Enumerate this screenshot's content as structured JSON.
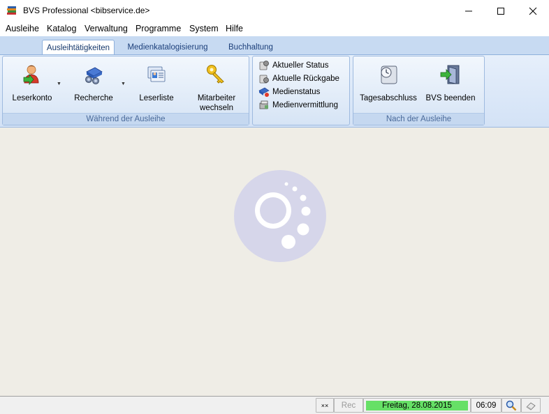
{
  "window": {
    "title": "BVS Professional <bibservice.de>",
    "controls": {
      "minimize": "—",
      "maximize": "☐",
      "close": "✕"
    }
  },
  "menu": [
    "Ausleihe",
    "Katalog",
    "Verwaltung",
    "Programme",
    "System",
    "Hilfe"
  ],
  "ribbon": {
    "tabs": [
      "Ausleihtätigkeiten",
      "Medienkatalogisierung",
      "Buchhaltung"
    ],
    "active_tab": "Ausleihtätigkeiten",
    "group1": {
      "caption": "Während der Ausleihe",
      "buttons": [
        "Leserkonto",
        "Recherche",
        "Leserliste",
        "Mitarbeiter\nwechseln"
      ],
      "mitarbeiter_line1": "Mitarbeiter",
      "mitarbeiter_line2": "wechseln"
    },
    "group2": {
      "items": [
        "Aktueller Status",
        "Aktuelle Rückgabe",
        "Medienstatus",
        "Medienvermittlung"
      ]
    },
    "group3": {
      "caption": "Nach der Ausleihe",
      "buttons": [
        "Tagesabschluss",
        "BVS beenden"
      ]
    }
  },
  "statusbar": {
    "indicator": "××",
    "rec": "Rec",
    "date": "Freitag, 28.08.2015",
    "time": "06:09"
  },
  "colors": {
    "ribbon": "#c7daf2",
    "workspace": "#efede6",
    "date_panel": "#66e066",
    "logo": "#d6d6ea"
  }
}
